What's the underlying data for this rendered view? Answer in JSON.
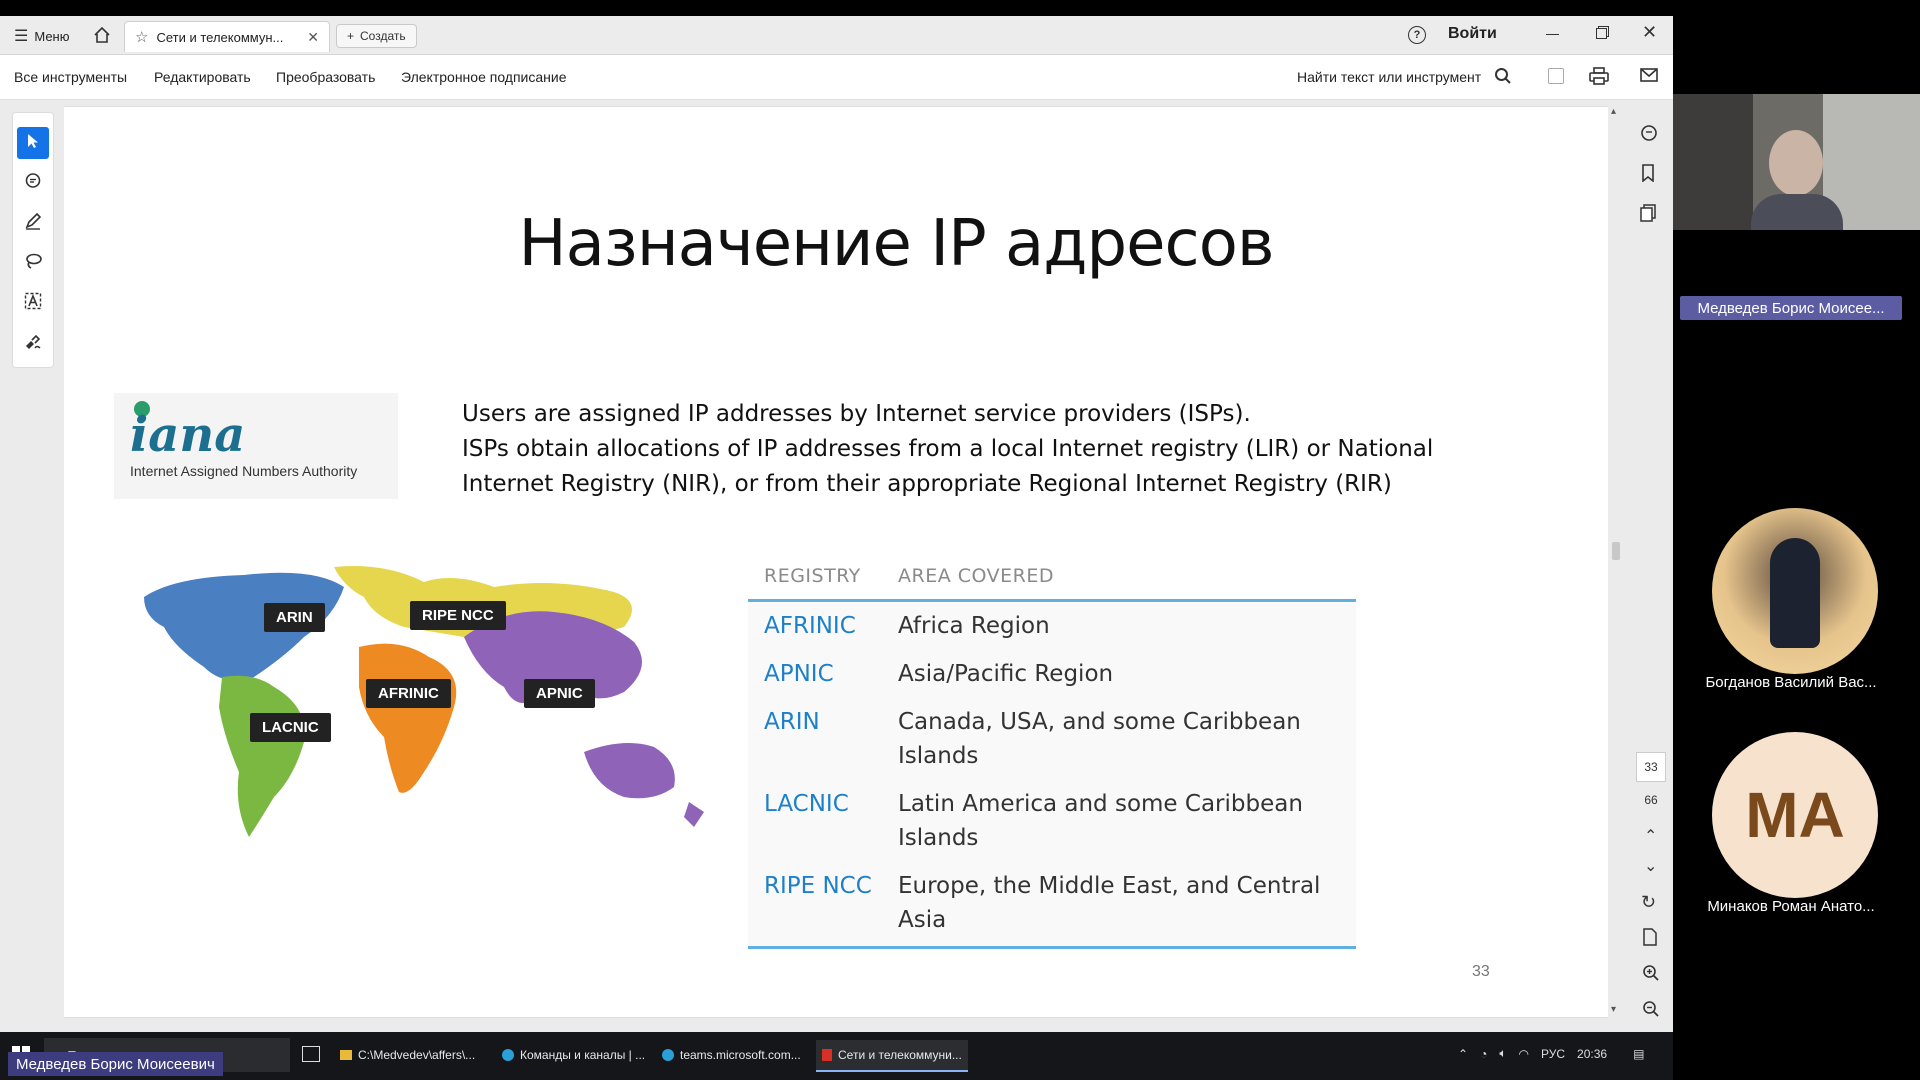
{
  "window": {
    "menu_label": "Меню",
    "tab_title": "Сети и телекоммун...",
    "create_label": "Создать",
    "login_label": "Войти"
  },
  "toolbar": {
    "items": [
      "Все инструменты",
      "Редактировать",
      "Преобразовать",
      "Электронное подписание"
    ],
    "search_label": "Найти текст или инструмент"
  },
  "slide": {
    "title": "Назначение IP адресов",
    "logo_word": "iana",
    "logo_sub": "Internet Assigned Numbers Authority",
    "para1": "Users are assigned IP addresses by Internet service providers (ISPs).",
    "para2": "ISPs obtain allocations of IP addresses from a local Internet registry (LIR) or National",
    "para3": "Internet Registry (NIR), or from their appropriate Regional Internet Registry (RIR)",
    "map_labels": [
      "ARIN",
      "RIPE NCC",
      "AFRINIC",
      "APNIC",
      "LACNIC"
    ],
    "table_headers": [
      "REGISTRY",
      "AREA COVERED"
    ],
    "table_rows": [
      {
        "registry": "AFRINIC",
        "area": "Africa Region"
      },
      {
        "registry": "APNIC",
        "area": "Asia/Pacific Region"
      },
      {
        "registry": "ARIN",
        "area": "Canada, USA, and some Caribbean Islands"
      },
      {
        "registry": "LACNIC",
        "area": "Latin America and some Caribbean Islands"
      },
      {
        "registry": "RIPE NCC",
        "area": "Europe, the Middle East, and Central Asia"
      }
    ],
    "page_number": "33"
  },
  "pager": {
    "current": "33",
    "total": "66"
  },
  "participants": {
    "presenter_name": "Медведев Борис Моисее...",
    "p2_name": "Богданов Василий Вас...",
    "p3_initials": "МА",
    "p3_name": "Минаков Роман Анато...",
    "speaker_badge": "Медведев Борис Моисеевич"
  },
  "taskbar": {
    "search_placeholder": "Поиск",
    "tasks": [
      "C:\\Medvedev\\affers\\...",
      "Команды и каналы | ...",
      "teams.microsoft.com...",
      "Сети и телекоммуни..."
    ],
    "lang": "РУС",
    "time": "20:36"
  },
  "colors": {
    "accent_blue": "#1e80c8",
    "tool_active": "#1473e6",
    "teams_badge": "#5c5ca3"
  }
}
